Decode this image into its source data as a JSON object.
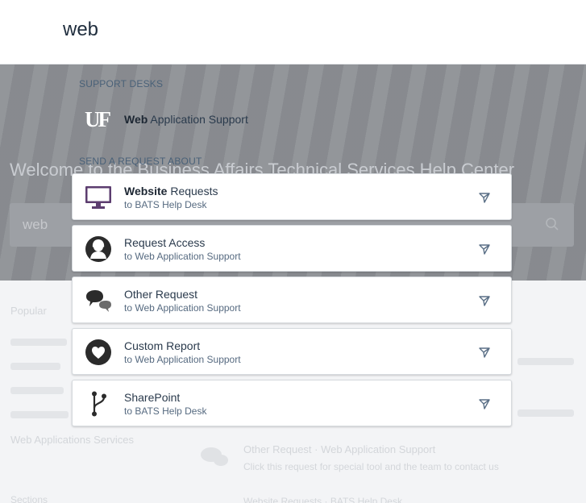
{
  "search": {
    "query": "web"
  },
  "background": {
    "welcome": "Welcome to the Business Affairs Technical Services Help Center",
    "search_value": "web",
    "popular_label": "Popular",
    "links": [
      "Web Applications Services"
    ],
    "article_title": "Other Request · Web Application Support",
    "article_sub": "Click this request for special tool and the team to contact us",
    "footer_left": "Sections",
    "footer_right": "Website Requests · BATS Help Desk"
  },
  "support_desks": {
    "heading": "SUPPORT DESKS",
    "items": [
      {
        "logo": "UF",
        "highlight": "Web",
        "rest": " Application Support"
      }
    ]
  },
  "requests": {
    "heading": "SEND A REQUEST ABOUT",
    "items": [
      {
        "highlight": "Website",
        "rest": " Requests",
        "sub": "to BATS Help Desk",
        "icon": "monitor-icon"
      },
      {
        "highlight": "",
        "rest": "Request Access",
        "sub": "to Web Application Support",
        "icon": "person-icon"
      },
      {
        "highlight": "",
        "rest": "Other Request",
        "sub": "to Web Application Support",
        "icon": "chat-bubbles-icon"
      },
      {
        "highlight": "",
        "rest": "Custom Report",
        "sub": "to Web Application Support",
        "icon": "heart-icon"
      },
      {
        "highlight": "",
        "rest": "SharePoint",
        "sub": "to BATS Help Desk",
        "icon": "branch-icon"
      }
    ]
  },
  "colors": {
    "monitor": "#5c3d6f",
    "dark_icon": "#2b2b2b",
    "send_icon": "#5a6f86"
  }
}
